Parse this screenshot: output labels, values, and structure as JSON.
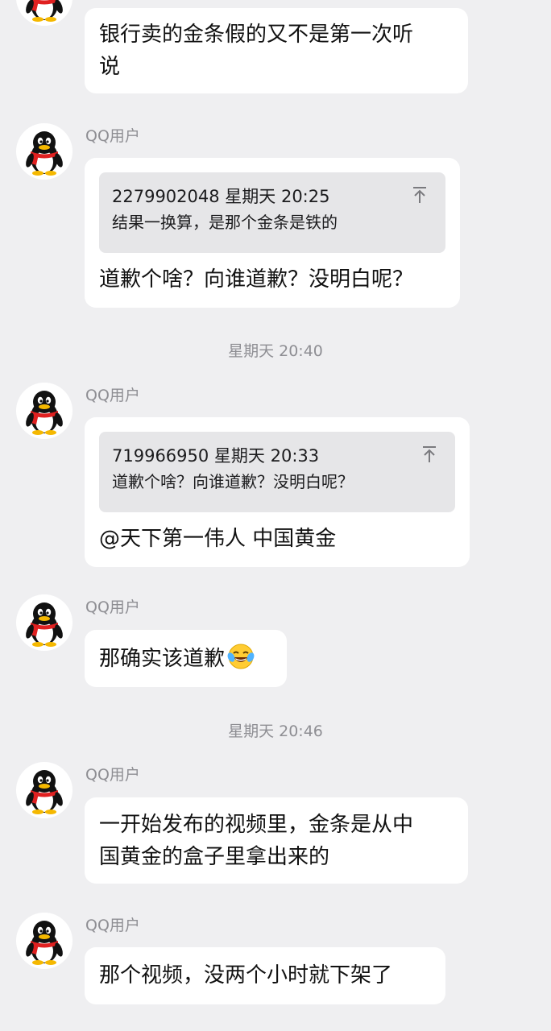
{
  "messages": [
    {
      "sender": "",
      "text": "银行卖的金条假的又不是第一次听\n说"
    },
    {
      "sender": "QQ用户",
      "quote": {
        "header": "2279902048 星期天 20:25",
        "text": "结果一换算，是那个金条是铁的"
      },
      "text": "道歉个啥？向谁道歉？没明白呢？"
    },
    {
      "sender": "QQ用户",
      "quote": {
        "header": "719966950 星期天 20:33",
        "text": "道歉个啥？向谁道歉？没明白呢？"
      },
      "text": "@天下第一伟人 中国黄金"
    },
    {
      "sender": "QQ用户",
      "text": "那确实该道歉",
      "emoji": "tears-of-joy-emoji"
    },
    {
      "sender": "QQ用户",
      "text": "一开始发布的视频里，金条是从中\n国黄金的盒子里拿出来的"
    },
    {
      "sender": "QQ用户",
      "text": "那个视频，没两个小时就下架了"
    }
  ],
  "time_dividers": [
    "星期天 20:40",
    "星期天 20:46"
  ],
  "colors": {
    "background": "#efeff1",
    "bubble": "#ffffff",
    "quote_background": "#e6e6e8",
    "muted_text": "#8e8e93",
    "avatar_scarf": "#e02020"
  }
}
